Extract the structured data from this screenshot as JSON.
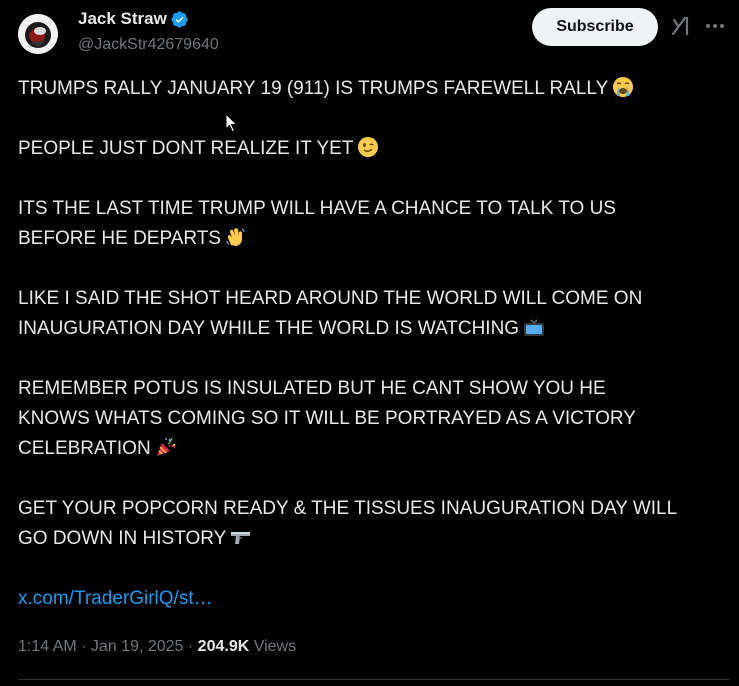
{
  "author": {
    "display_name": "Jack Straw",
    "handle": "@JackStr42679640",
    "verified": true,
    "verified_color": "#1d9bf0"
  },
  "actions": {
    "subscribe_label": "Subscribe",
    "grok_icon": "grok-icon",
    "more_icon": "more-horizontal-icon"
  },
  "tweet": {
    "paragraphs": [
      {
        "lines": [
          "TRUMPS RALLY JANUARY 19 (911) IS TRUMPS FAREWELL RALLY"
        ],
        "emoji": "loudly-crying-face"
      },
      {
        "lines": [
          "PEOPLE JUST DONT REALIZE IT YET"
        ],
        "emoji": "winking-face"
      },
      {
        "lines": [
          "ITS THE LAST TIME TRUMP WILL HAVE A CHANCE TO TALK TO US",
          "BEFORE HE DEPARTS"
        ],
        "emoji": "waving-hand"
      },
      {
        "lines": [
          "LIKE I SAID THE SHOT HEARD AROUND THE WORLD WILL COME ON",
          "INAUGURATION DAY WHILE THE WORLD IS WATCHING"
        ],
        "emoji": "television"
      },
      {
        "lines": [
          "REMEMBER POTUS IS INSULATED BUT HE CANT SHOW YOU HE",
          "KNOWS WHATS COMING SO IT WILL BE PORTRAYED AS A VICTORY",
          "CELEBRATION"
        ],
        "emoji": "party-popper"
      },
      {
        "lines": [
          "GET YOUR POPCORN READY & THE TISSUES INAUGURATION DAY WILL",
          "GO DOWN IN HISTORY"
        ],
        "emoji": "pistol"
      }
    ],
    "link_text": "x.com/TraderGirlQ/st…",
    "link_color": "#1d9bf0"
  },
  "meta": {
    "time": "1:14 AM",
    "separator": " · ",
    "date": "Jan 19, 2025",
    "views_count": "204.9K",
    "views_label": "Views"
  }
}
